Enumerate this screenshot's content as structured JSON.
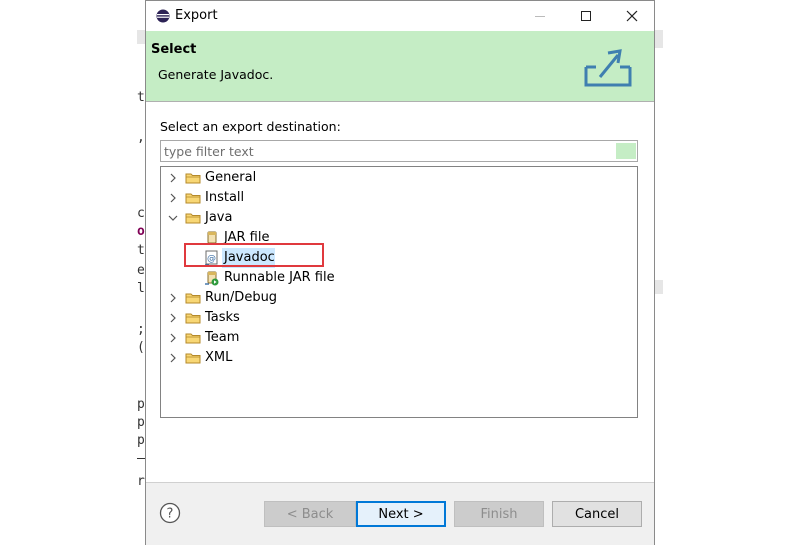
{
  "window": {
    "title": "Export"
  },
  "banner": {
    "heading": "Select",
    "description": "Generate Javadoc."
  },
  "content": {
    "prompt": "Select an export destination:",
    "filter_placeholder": "type filter text"
  },
  "tree": {
    "items": [
      {
        "label": "General",
        "level": 0,
        "expanded": false,
        "icon": "folder-icon"
      },
      {
        "label": "Install",
        "level": 0,
        "expanded": false,
        "icon": "folder-icon"
      },
      {
        "label": "Java",
        "level": 0,
        "expanded": true,
        "icon": "folder-icon"
      },
      {
        "label": "JAR file",
        "level": 1,
        "icon": "jar-file-icon"
      },
      {
        "label": "Javadoc",
        "level": 1,
        "selected": true,
        "icon": "javadoc-icon"
      },
      {
        "label": "Runnable JAR file",
        "level": 1,
        "icon": "runnable-jar-icon"
      },
      {
        "label": "Run/Debug",
        "level": 0,
        "expanded": false,
        "icon": "folder-icon"
      },
      {
        "label": "Tasks",
        "level": 0,
        "expanded": false,
        "icon": "folder-icon"
      },
      {
        "label": "Team",
        "level": 0,
        "expanded": false,
        "icon": "folder-icon"
      },
      {
        "label": "XML",
        "level": 0,
        "expanded": false,
        "icon": "folder-icon"
      }
    ]
  },
  "buttons": {
    "back": "< Back",
    "next": "Next >",
    "finish": "Finish",
    "cancel": "Cancel"
  },
  "background_editor": {
    "fragments": [
      "t",
      ",",
      "c",
      "o",
      "t",
      "e",
      "l",
      ";",
      "(",
      "p",
      "p",
      "p",
      "r"
    ]
  },
  "colors": {
    "banner": "#c5edc5",
    "selection": "#cce8ff",
    "highlight": "#e0393e",
    "default_button_border": "#0078d7"
  }
}
